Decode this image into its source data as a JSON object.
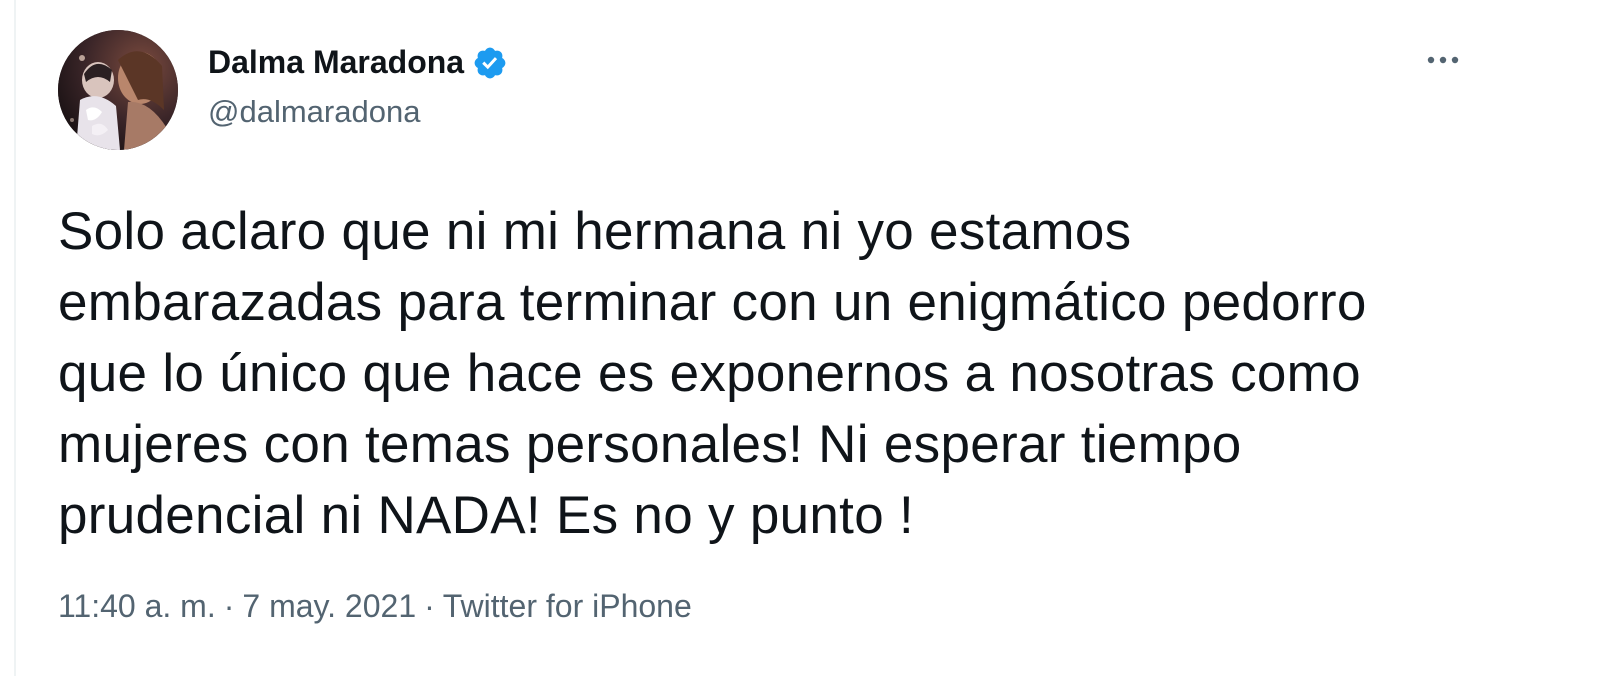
{
  "tweet": {
    "author": {
      "display_name": "Dalma Maradona",
      "handle": "@dalmaradona",
      "verified": true,
      "avatar_icon": "profile-photo"
    },
    "more_icon": "more-horizontal-icon",
    "text_lines": [
      "Solo aclaro que ni mi hermana ni yo estamos",
      "embarazadas para terminar con un enigmático pedorro",
      "que lo único que hace es exponernos a nosotras como",
      "mujeres con temas personales! Ni esperar tiempo",
      "prudencial ni NADA! Es no y punto !"
    ],
    "time": "11:40 a. m.",
    "separator": "·",
    "date": "7 may. 2021",
    "source": "Twitter for iPhone"
  },
  "colors": {
    "text_primary": "#0f1419",
    "text_secondary": "#536471",
    "verified_blue": "#1d9bf0"
  }
}
